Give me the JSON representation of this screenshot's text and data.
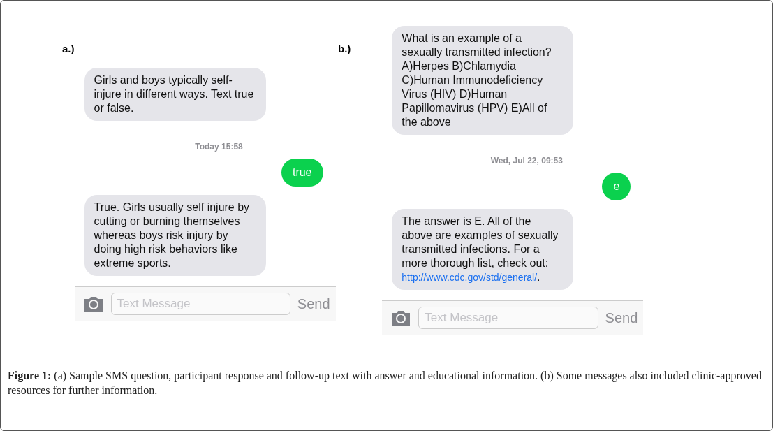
{
  "panels": [
    {
      "label": "a.)",
      "messages": [
        {
          "kind": "incoming",
          "text": "Girls and boys typically self-injure in different ways. Text true or false."
        },
        {
          "kind": "timestamp",
          "text": "Today 15:58"
        },
        {
          "kind": "outgoing",
          "text": "true"
        },
        {
          "kind": "incoming",
          "text": "True. Girls usually self injure by cutting or burning themselves whereas boys risk injury by doing high risk behaviors like extreme sports."
        }
      ],
      "composer": {
        "placeholder": "Text Message",
        "send": "Send"
      }
    },
    {
      "label": "b.)",
      "messages": [
        {
          "kind": "incoming",
          "text": "What is an example of a sexually transmitted infection?A)Herpes B)Chlamydia C)Human Immunodeficiency Virus (HIV) D)Human Papillomavirus (HPV) E)All of the above"
        },
        {
          "kind": "timestamp",
          "text": "Wed, Jul 22, 09:53"
        },
        {
          "kind": "outgoing",
          "text": "e"
        },
        {
          "kind": "incoming",
          "text": "The answer is E. All of the above are examples of sexually transmitted infections. For a more thorough list, check out:",
          "link": "http://www.cdc.gov/std/general/",
          "after": "."
        }
      ],
      "composer": {
        "placeholder": "Text Message",
        "send": "Send"
      }
    }
  ],
  "caption": "**Figure 1:** (a) Sample SMS question, participant response and follow-up text with answer and educational information. (b) Some messages also included clinic-approved resources for further information."
}
